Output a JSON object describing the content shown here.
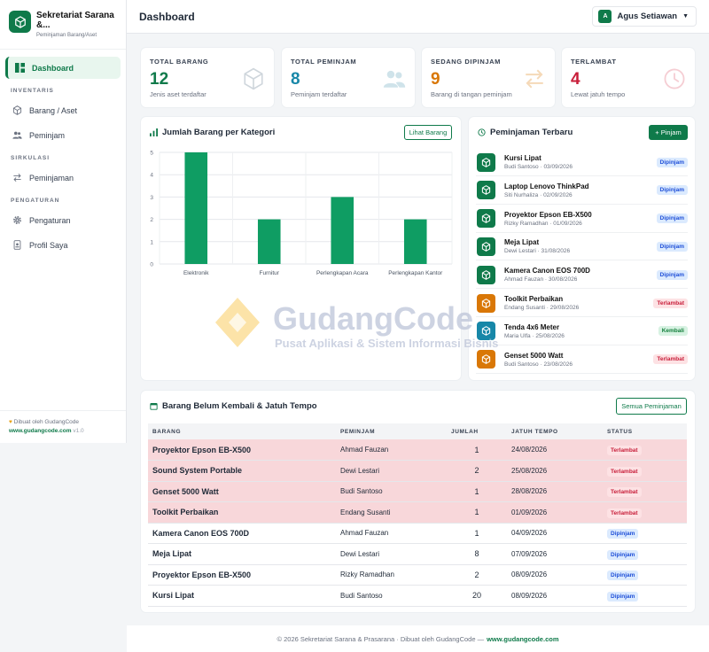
{
  "sidebar": {
    "app_title": "Sekretariat Sarana &...",
    "app_subtitle": "Peminjaman Barang/Aset",
    "sections": {
      "inventaris": "INVENTARIS",
      "sirkulasi": "SIRKULASI",
      "pengaturan": "PENGATURAN"
    },
    "items": {
      "dashboard": "Dashboard",
      "barang": "Barang / Aset",
      "peminjam": "Peminjam",
      "peminjaman": "Peminjaman",
      "pengaturan": "Pengaturan",
      "profil": "Profil Saya"
    },
    "footer_made_by": "Dibuat oleh GudangCode",
    "footer_link": "www.gudangcode.com",
    "footer_version": "v1.0"
  },
  "header": {
    "title": "Dashboard",
    "user_name": "Agus Setiawan",
    "user_initial": "A"
  },
  "stats": [
    {
      "label": "TOTAL BARANG",
      "value": "12",
      "desc": "Jenis aset terdaftar",
      "color": "#0f7a4a",
      "icon": "box-icon"
    },
    {
      "label": "TOTAL PEMINJAM",
      "value": "8",
      "desc": "Peminjam terdaftar",
      "color": "#1787a8",
      "icon": "users-icon"
    },
    {
      "label": "SEDANG DIPINJAM",
      "value": "9",
      "desc": "Barang di tangan peminjam",
      "color": "#d97706",
      "icon": "swap-icon"
    },
    {
      "label": "TERLAMBAT",
      "value": "4",
      "desc": "Lewat jatuh tempo",
      "color": "#c81e3a",
      "icon": "clock-icon"
    }
  ],
  "chart_panel": {
    "title": "Jumlah Barang per Kategori",
    "button": "Lihat Barang"
  },
  "chart_data": {
    "type": "bar",
    "title": "",
    "categories": [
      "Elektronik",
      "Furnitur",
      "Perlengkapan Acara",
      "Perlengkapan Kantor"
    ],
    "values": [
      5,
      2,
      3,
      2
    ],
    "ylim": [
      0,
      5
    ],
    "yticks": [
      0,
      1,
      2,
      3,
      4,
      5
    ],
    "color": "#0f9d63",
    "grid": true
  },
  "recent": {
    "title": "Peminjaman Terbaru",
    "button": "+ Pinjam",
    "items": [
      {
        "name": "Kursi Lipat",
        "meta": "Budi Santoso · 03/09/2026",
        "status": "Dipinjam",
        "kind": "blue",
        "icon_color": "#0f7a4a"
      },
      {
        "name": "Laptop Lenovo ThinkPad",
        "meta": "Siti Nurhaliza · 02/09/2026",
        "status": "Dipinjam",
        "kind": "blue",
        "icon_color": "#0f7a4a"
      },
      {
        "name": "Proyektor Epson EB-X500",
        "meta": "Rizky Ramadhan · 01/09/2026",
        "status": "Dipinjam",
        "kind": "blue",
        "icon_color": "#0f7a4a"
      },
      {
        "name": "Meja Lipat",
        "meta": "Dewi Lestari · 31/08/2026",
        "status": "Dipinjam",
        "kind": "blue",
        "icon_color": "#0f7a4a"
      },
      {
        "name": "Kamera Canon EOS 700D",
        "meta": "Ahmad Fauzan · 30/08/2026",
        "status": "Dipinjam",
        "kind": "blue",
        "icon_color": "#0f7a4a"
      },
      {
        "name": "Toolkit Perbaikan",
        "meta": "Endang Susanti · 29/08/2026",
        "status": "Terlambat",
        "kind": "red",
        "icon_color": "#d97706"
      },
      {
        "name": "Tenda 4x6 Meter",
        "meta": "Maria Ulfa · 25/08/2026",
        "status": "Kembali",
        "kind": "green",
        "icon_color": "#1787a8"
      },
      {
        "name": "Genset 5000 Watt",
        "meta": "Budi Santoso · 23/08/2026",
        "status": "Terlambat",
        "kind": "red",
        "icon_color": "#d97706"
      }
    ]
  },
  "overdue": {
    "title": "Barang Belum Kembali & Jatuh Tempo",
    "button": "Semua Peminjaman",
    "columns": [
      "BARANG",
      "PEMINJAM",
      "JUMLAH",
      "JATUH TEMPO",
      "STATUS"
    ],
    "rows": [
      {
        "item": "Proyektor Epson EB-X500",
        "borrower": "Ahmad Fauzan",
        "qty": "1",
        "due": "24/08/2026",
        "status": "Terlambat",
        "late": true
      },
      {
        "item": "Sound System Portable",
        "borrower": "Dewi Lestari",
        "qty": "2",
        "due": "25/08/2026",
        "status": "Terlambat",
        "late": true
      },
      {
        "item": "Genset 5000 Watt",
        "borrower": "Budi Santoso",
        "qty": "1",
        "due": "28/08/2026",
        "status": "Terlambat",
        "late": true
      },
      {
        "item": "Toolkit Perbaikan",
        "borrower": "Endang Susanti",
        "qty": "1",
        "due": "01/09/2026",
        "status": "Terlambat",
        "late": true
      },
      {
        "item": "Kamera Canon EOS 700D",
        "borrower": "Ahmad Fauzan",
        "qty": "1",
        "due": "04/09/2026",
        "status": "Dipinjam",
        "late": false
      },
      {
        "item": "Meja Lipat",
        "borrower": "Dewi Lestari",
        "qty": "8",
        "due": "07/09/2026",
        "status": "Dipinjam",
        "late": false
      },
      {
        "item": "Proyektor Epson EB-X500",
        "borrower": "Rizky Ramadhan",
        "qty": "2",
        "due": "08/09/2026",
        "status": "Dipinjam",
        "late": false
      },
      {
        "item": "Kursi Lipat",
        "borrower": "Budi Santoso",
        "qty": "20",
        "due": "08/09/2026",
        "status": "Dipinjam",
        "late": false
      }
    ]
  },
  "footer": {
    "text": "© 2026 Sekretariat Sarana & Prasarana · Dibuat oleh GudangCode —",
    "link": "www.gudangcode.com"
  },
  "watermark": {
    "title": "GudangCode",
    "subtitle": "Pusat Aplikasi & Sistem Informasi Bisnis"
  }
}
